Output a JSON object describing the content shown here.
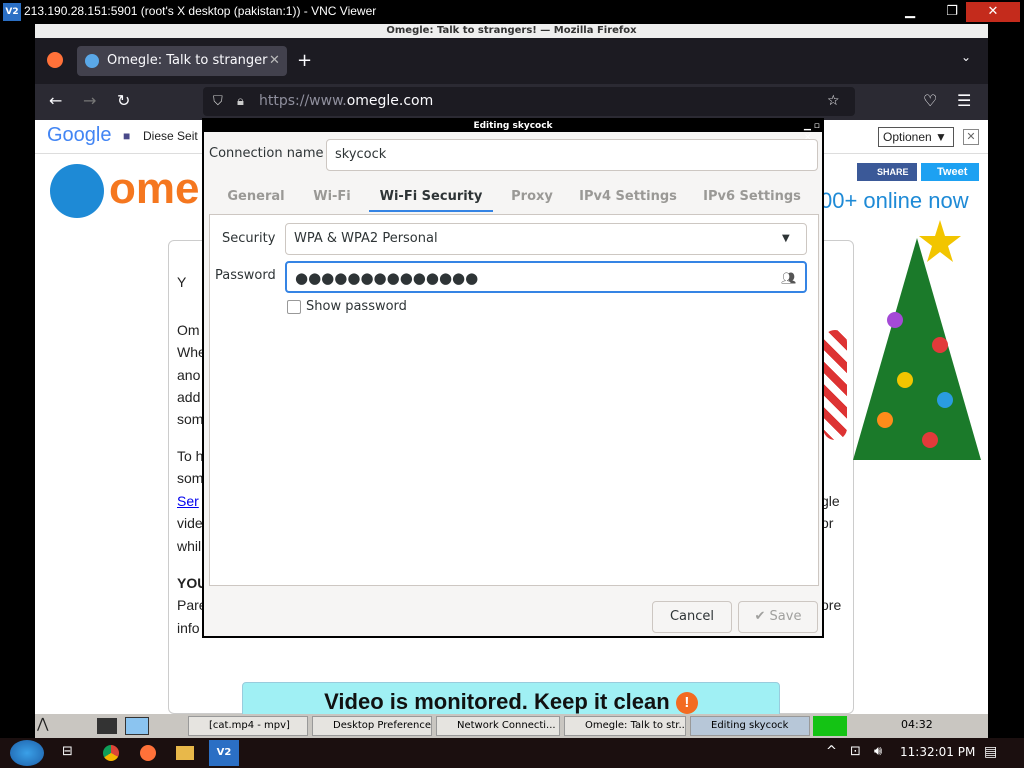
{
  "vnc": {
    "title": "213.190.28.151:5901 (root's X desktop (pakistan:1)) - VNC Viewer",
    "logo": "V2"
  },
  "firefox": {
    "window_title": "Omegle: Talk to strangers! — Mozilla Firefox",
    "tab_title": "Omegle: Talk to stranger",
    "url_prefix": "https://www.",
    "url_domain": "omegle.com"
  },
  "page": {
    "google_brand": "Google",
    "google_notice": "Diese Seit",
    "optionen": "Optionen ▼",
    "logo_text": "ome",
    "share": "SHARE",
    "tweet": "Tweet",
    "online_now": "00+ online now",
    "text_lines": [
      "Y",
      "Om",
      "Whe",
      "ano",
      "add",
      "som",
      "To h",
      "som",
      "Ser",
      "vide",
      "whil",
      "YOU",
      "Pare",
      "info"
    ],
    "right_text": [
      "gle",
      "or",
      "ore"
    ],
    "banner": "Video is monitored. Keep it clean",
    "banner_icon": "!"
  },
  "dialog": {
    "title": "Editing skycock",
    "connection_name_label": "Connection name",
    "connection_name": "skycock",
    "tabs": [
      "General",
      "Wi-Fi",
      "Wi-Fi Security",
      "Proxy",
      "IPv4 Settings",
      "IPv6 Settings"
    ],
    "security_label": "Security",
    "security_value": "WPA & WPA2 Personal",
    "password_label": "Password",
    "password_value": "●●●●●●●●●●●●●●",
    "show_password": "Show password",
    "cancel": "Cancel",
    "save": "✔ Save"
  },
  "lxpanel": {
    "tasks": [
      "[cat.mp4 - mpv]",
      "Desktop Preferences",
      "Network Connecti...",
      "Omegle: Talk to str...",
      "Editing skycock"
    ],
    "clock": "04:32"
  },
  "windows": {
    "clock": "11:32:01 PM",
    "v2": "V2"
  }
}
